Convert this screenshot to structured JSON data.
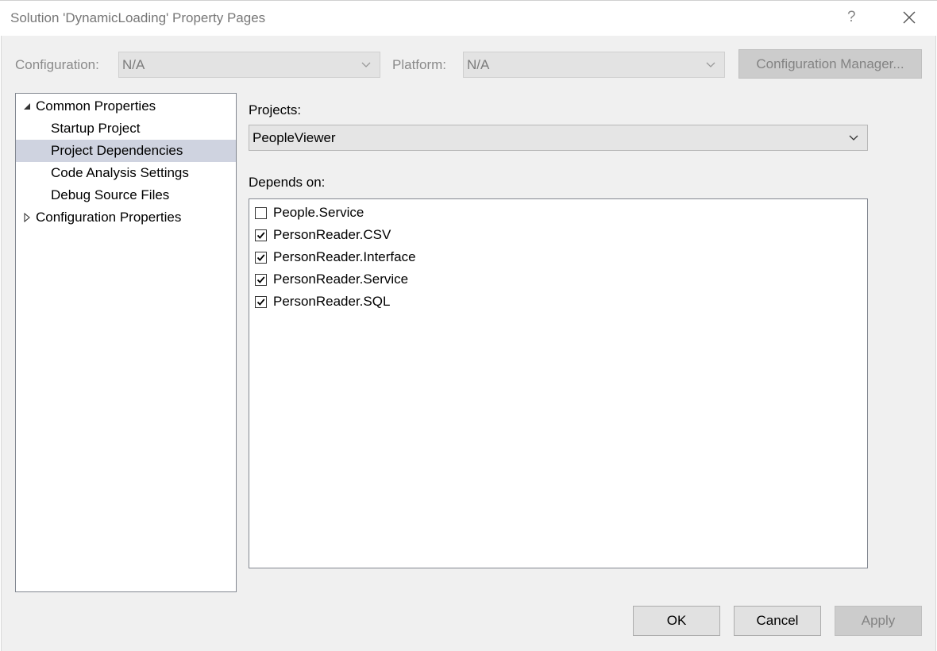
{
  "window": {
    "title": "Solution 'DynamicLoading' Property Pages",
    "help_glyph": "?"
  },
  "config_bar": {
    "configuration_label": "Configuration:",
    "configuration_value": "N/A",
    "platform_label": "Platform:",
    "platform_value": "N/A",
    "config_manager_label": "Configuration Manager..."
  },
  "tree": {
    "items": [
      {
        "label": "Common Properties",
        "level": 0,
        "expanded": true
      },
      {
        "label": "Startup Project",
        "level": 1
      },
      {
        "label": "Project Dependencies",
        "level": 1,
        "selected": true
      },
      {
        "label": "Code Analysis Settings",
        "level": 1
      },
      {
        "label": "Debug Source Files",
        "level": 1
      },
      {
        "label": "Configuration Properties",
        "level": 0,
        "expanded": false
      }
    ]
  },
  "main": {
    "projects_label": "Projects:",
    "projects_value": "PeopleViewer",
    "depends_label": "Depends on:",
    "dependencies": [
      {
        "label": "People.Service",
        "checked": false
      },
      {
        "label": "PersonReader.CSV",
        "checked": true
      },
      {
        "label": "PersonReader.Interface",
        "checked": true
      },
      {
        "label": "PersonReader.Service",
        "checked": true
      },
      {
        "label": "PersonReader.SQL",
        "checked": true
      }
    ]
  },
  "footer": {
    "ok_label": "OK",
    "cancel_label": "Cancel",
    "apply_label": "Apply"
  },
  "colors": {
    "selection": "#cfd3e0",
    "disabled_text": "#838383"
  }
}
